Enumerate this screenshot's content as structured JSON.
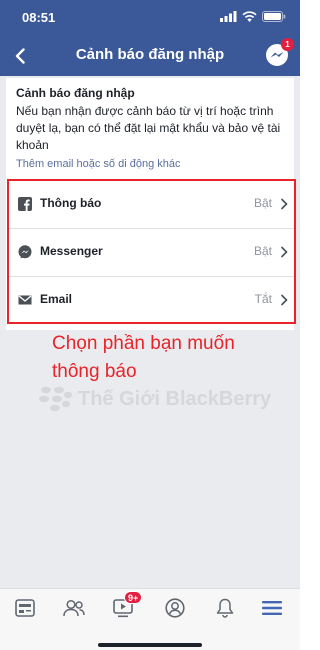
{
  "status_bar": {
    "time": "08:51"
  },
  "nav": {
    "title": "Cảnh báo đăng nhập",
    "messenger_badge": "1"
  },
  "card": {
    "title": "Cảnh báo đăng nhập",
    "description": "Nếu bạn nhận được cảnh báo từ vị trí hoặc trình duyệt lạ, bạn có thể đặt lại mật khẩu và bảo vệ tài khoản",
    "link": "Thêm email hoặc số di động khác"
  },
  "rows": [
    {
      "icon": "facebook-icon",
      "label": "Thông báo",
      "status": "Bật"
    },
    {
      "icon": "messenger-icon",
      "label": "Messenger",
      "status": "Bật"
    },
    {
      "icon": "email-icon",
      "label": "Email",
      "status": "Tắt"
    }
  ],
  "annotation": {
    "line1": "Chọn phần bạn muốn",
    "line2": "thông báo"
  },
  "watermark": {
    "text": "Thế Giới BlackBerry"
  },
  "tab_bar": {
    "tabs": [
      "news-feed-icon",
      "friends-icon",
      "watch-icon",
      "profile-icon",
      "notifications-icon",
      "menu-icon"
    ],
    "watch_badge": "9+"
  },
  "colors": {
    "brand": "#3b5998",
    "annotation": "#e8242a",
    "badge": "#e41e3f",
    "active_tab": "#4267b2"
  }
}
